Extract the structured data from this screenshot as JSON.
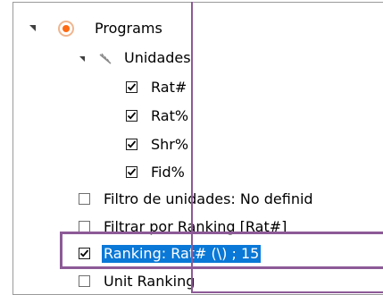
{
  "tree": {
    "root": {
      "label": "Programs",
      "icon": "radio-orange-icon"
    },
    "group": {
      "label": "Unidades",
      "icon": "units-group-icon"
    },
    "units": [
      {
        "label": "Rat#",
        "checked": true
      },
      {
        "label": "Rat%",
        "checked": true
      },
      {
        "label": "Shr%",
        "checked": true
      },
      {
        "label": "Fid%",
        "checked": true
      }
    ],
    "filters": [
      {
        "label": "Filtro de unidades: No definid",
        "checked": false
      },
      {
        "label": "Filtrar por Ranking [Rat#]",
        "checked": false
      },
      {
        "label": "Ranking: Rat# (\\) ; 15",
        "checked": true,
        "selected": true
      },
      {
        "label": "Unit Ranking",
        "checked": false
      }
    ]
  },
  "colors": {
    "selection": "#0a78d7",
    "radio_orange": "#ff6a13",
    "annotation_frame": "#8d5a97",
    "checkbox_border": "#1c1c1c"
  }
}
